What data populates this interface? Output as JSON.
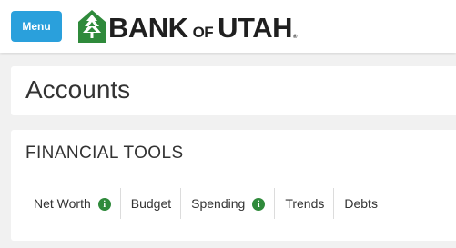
{
  "header": {
    "menu_label": "Menu",
    "logo": {
      "word1": "BANK",
      "word2": "OF",
      "word3": "UTAH",
      "trademark": "®"
    }
  },
  "accounts": {
    "title": "Accounts"
  },
  "financial_tools": {
    "title": "FINANCIAL TOOLS",
    "tabs": [
      {
        "label": "Net Worth",
        "icon": "info-icon"
      },
      {
        "label": "Budget"
      },
      {
        "label": "Spending",
        "icon": "info-icon"
      },
      {
        "label": "Trends"
      },
      {
        "label": "Debts"
      }
    ]
  },
  "colors": {
    "menu_button": "#2aa0dc",
    "logo_green": "#2f8a3b",
    "background": "#f1f1f1",
    "info_icon": "#2f8a3b"
  }
}
